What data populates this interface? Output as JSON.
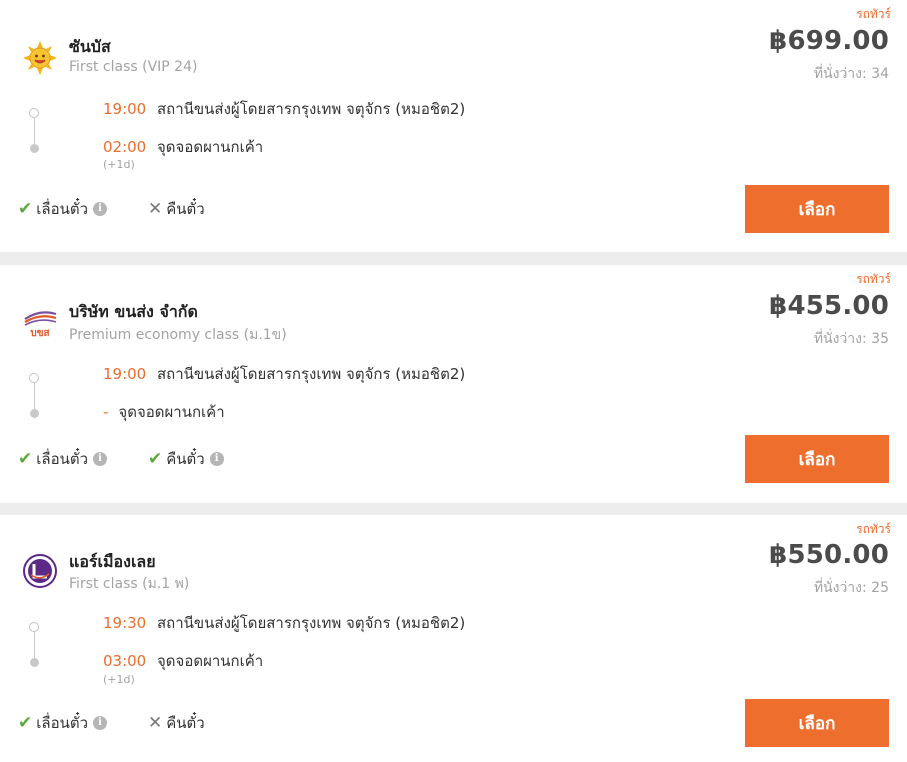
{
  "results": [
    {
      "tag": "รถทัวร์",
      "operator": "ซันบัส",
      "seat_class": "First class (VIP 24)",
      "price": "฿699.00",
      "seats": "ที่นั่งว่าง: 34",
      "depart_time": "19:00",
      "depart_station": "สถานีขนส่งผู้โดยสารกรุงเทพ จตุจักร (หมอชิต2)",
      "arrive_time": "02:00",
      "arrive_station": "จุดจอดผานกเค้า",
      "next_day": "(+1d)",
      "policy_change": "เลื่อนตั๋ว",
      "policy_refund": "คืนตั๋ว",
      "select_label": "เลือก"
    },
    {
      "tag": "รถทัวร์",
      "operator": "บริษัท ขนส่ง จำกัด",
      "seat_class": "Premium economy class (ม.1ข)",
      "price": "฿455.00",
      "seats": "ที่นั่งว่าง: 35",
      "depart_time": "19:00",
      "depart_station": "สถานีขนส่งผู้โดยสารกรุงเทพ จตุจักร (หมอชิต2)",
      "arrive_time": "-",
      "arrive_station": "จุดจอดผานกเค้า",
      "policy_change": "เลื่อนตั๋ว",
      "policy_refund": "คืนตั๋ว",
      "select_label": "เลือก"
    },
    {
      "tag": "รถทัวร์",
      "operator": "แอร์เมืองเลย",
      "seat_class": "First class (ม.1 พ)",
      "price": "฿550.00",
      "seats": "ที่นั่งว่าง: 25",
      "depart_time": "19:30",
      "depart_station": "สถานีขนส่งผู้โดยสารกรุงเทพ จตุจักร (หมอชิต2)",
      "arrive_time": "03:00",
      "arrive_station": "จุดจอดผานกเค้า",
      "next_day": "(+1d)",
      "policy_change": "เลื่อนตั๋ว",
      "policy_refund": "คืนตั๋ว",
      "select_label": "เลือก"
    }
  ],
  "logos": {
    "sunbus_text": "",
    "bks_text": "บขส"
  },
  "icons": {
    "check": "✔",
    "cross": "✕",
    "info": "i"
  },
  "colors": {
    "accent": "#ee6e2d",
    "time": "#ee6c2c",
    "check": "#5aaa3c"
  },
  "policy_state": [
    {
      "change_allowed": true,
      "refund_allowed": false
    },
    {
      "change_allowed": true,
      "refund_allowed": true
    },
    {
      "change_allowed": true,
      "refund_allowed": false
    }
  ]
}
